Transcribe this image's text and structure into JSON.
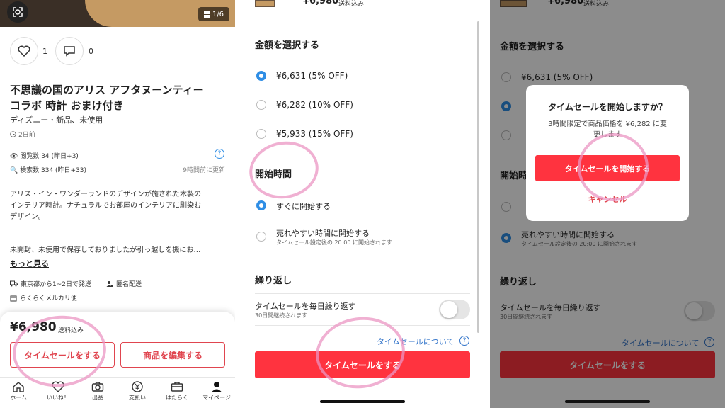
{
  "panel1": {
    "image_counter": "1/6",
    "like_count": "1",
    "comment_count": "0",
    "title_line1": "不思議の国のアリス アフタヌーンティー",
    "title_line2": "コラボ 時計 おまけ付き",
    "subtitle": "ディズニー・新品、未使用",
    "posted": "2日前",
    "views_label": "閲覧数",
    "views_value": "34 (昨日+3)",
    "search_label": "検索数",
    "search_value": "334 (昨日+33)",
    "updated": "9時間前に更新",
    "desc_line1": "アリス・イン・ワンダーランドのデザインが施された木製の",
    "desc_line2": "インテリア時計。ナチュラルでお部屋のインテリアに馴染む",
    "desc_line3": "デザイン。",
    "desc_line4": "未開封、未使用で保存しておりましたが引っ越しを機にお…",
    "more": "もっと見る",
    "ship_from": "東京都から1~2日で発送",
    "anon": "匿名配送",
    "method": "らくらくメルカリ便",
    "price": "¥6,980",
    "shipping_incl": "送料込み",
    "btn_timesale": "タイムセールをする",
    "btn_edit": "商品を編集する",
    "nav": [
      "ホーム",
      "いいね！",
      "出品",
      "支払い",
      "はたらく",
      "マイページ"
    ]
  },
  "panel2": {
    "top_price": "¥6,980",
    "top_ship": "送料込み",
    "section_amount": "金額を選択する",
    "opt1": "¥6,631 (5% OFF)",
    "opt2": "¥6,282 (10% OFF)",
    "opt3": "¥5,933 (15% OFF)",
    "section_start": "開始時間",
    "start1": "すぐに開始する",
    "start2": "売れやすい時間に開始する",
    "start2_sub": "タイムセール設定後の 20:00 に開始されます",
    "section_repeat": "繰り返し",
    "repeat_label": "タイムセールを毎日繰り返す",
    "repeat_sub": "30日間継続されます",
    "about": "タイムセールについて",
    "btn": "タイムセールをする"
  },
  "panel3": {
    "top_price": "¥6,980",
    "top_ship": "送料込み",
    "section_amount": "金額を選択する",
    "opt1": "¥6,631 (5% OFF)",
    "start_partial": "開始時",
    "start2": "売れやすい時間に開始する",
    "start2_sub": "タイムセール設定後の 20:00 に開始されます",
    "section_repeat": "繰り返し",
    "repeat_label": "タイムセールを毎日繰り返す",
    "repeat_sub": "30日間継続されます",
    "about": "タイムセールについて",
    "btn": "タイムセールをする",
    "dialog_title": "タイムセールを開始しますか？",
    "dialog_body1": "3時間限定で商品価格を ¥6,282 に変",
    "dialog_body2": "更します",
    "dialog_confirm": "タイムセールを開始する",
    "dialog_cancel": "キャンセル"
  },
  "colors": {
    "accent_red": "#ff333f",
    "radio_blue": "#2f8ee5",
    "annotation_pink": "#eb96c3"
  }
}
